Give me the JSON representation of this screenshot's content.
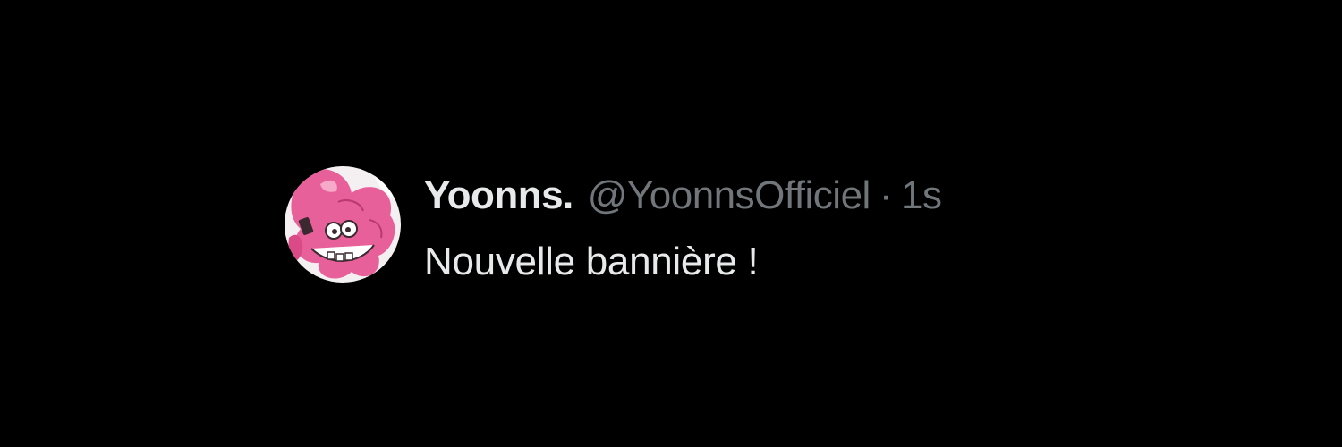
{
  "tweet": {
    "display_name": "Yoonns.",
    "handle": "@YoonnsOfficiel",
    "separator": "·",
    "time": "1s",
    "text": "Nouvelle bannière !",
    "avatar_icon": "pink-octopus-avatar-icon"
  },
  "colors": {
    "background": "#000000",
    "primary_text": "#e7e9ea",
    "secondary_text": "#71767b",
    "avatar_pink": "#e8609a"
  }
}
